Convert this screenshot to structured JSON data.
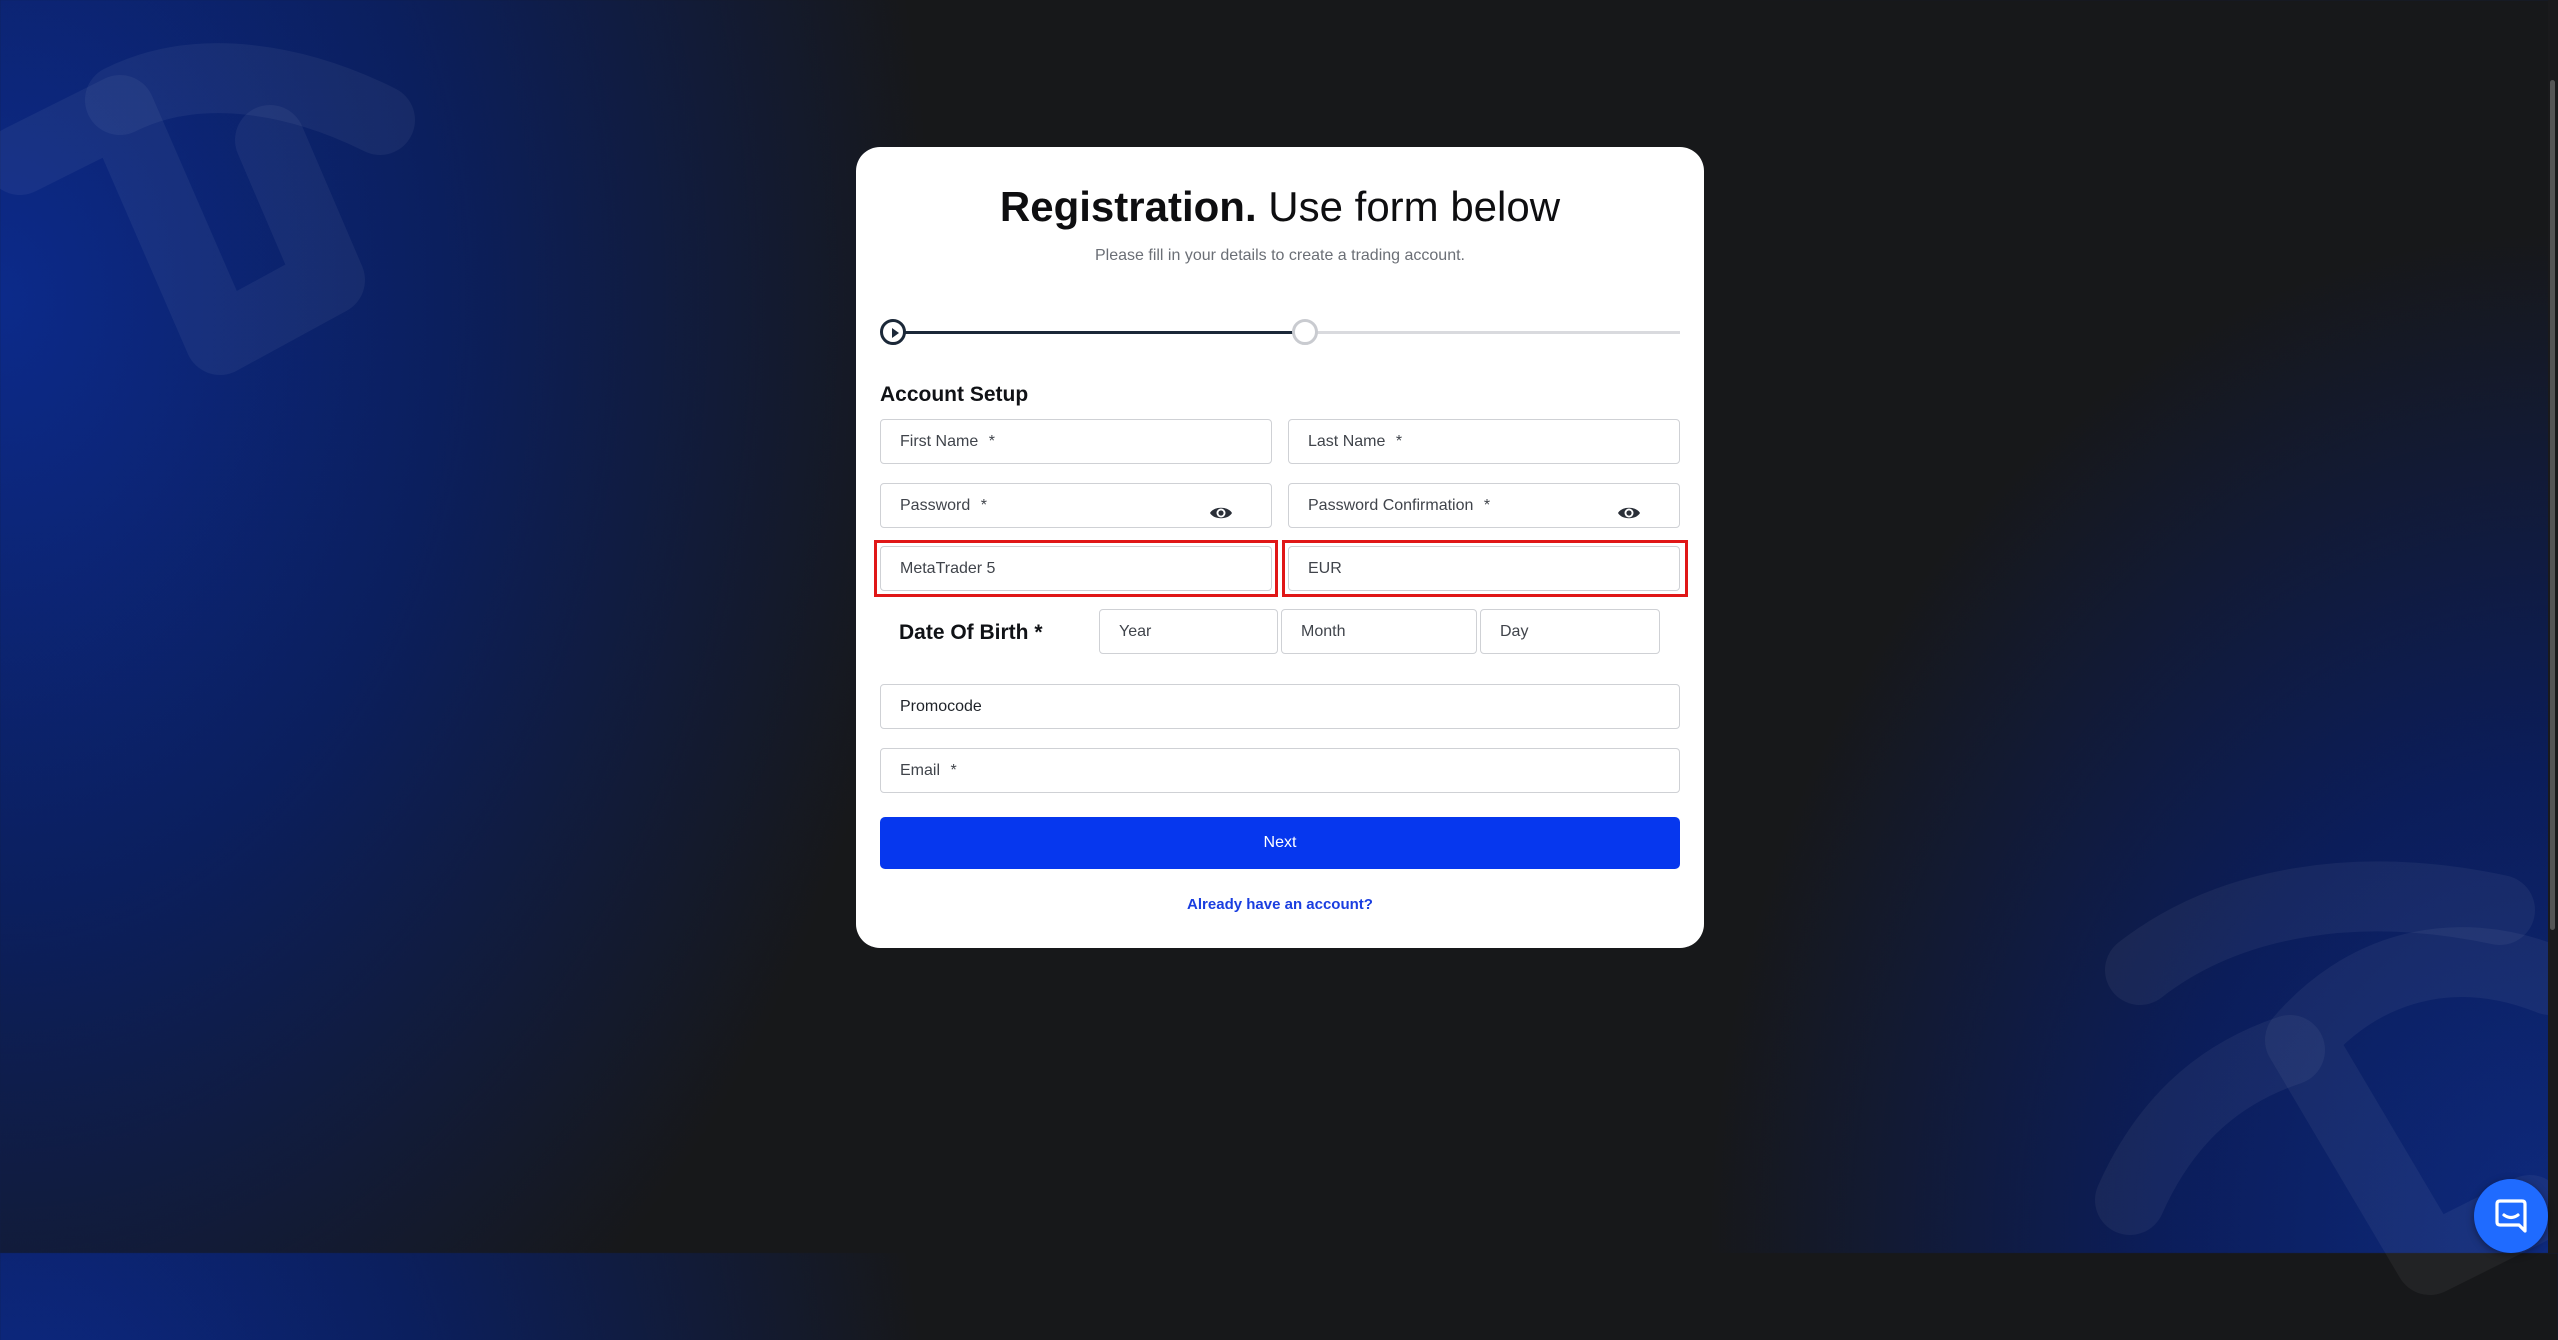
{
  "header": {
    "title_bold": "Registration.",
    "title_light": "Use form below",
    "subtitle": "Please fill in your details to create a trading account."
  },
  "progress": {
    "current_step": 1,
    "total_steps": 2,
    "fill_fraction": 0.5
  },
  "section_title": "Account Setup",
  "fields": {
    "first_name": {
      "placeholder": "First Name",
      "required_mark": "*"
    },
    "last_name": {
      "placeholder": "Last Name",
      "required_mark": "*"
    },
    "password": {
      "placeholder": "Password",
      "required_mark": "*"
    },
    "password_confirmation": {
      "placeholder": "Password Confirmation",
      "required_mark": "*"
    },
    "platform": {
      "value": "MetaTrader 5"
    },
    "currency": {
      "value": "EUR"
    },
    "promocode": {
      "placeholder": "Promocode"
    },
    "email": {
      "placeholder": "Email",
      "required_mark": "*"
    }
  },
  "dob": {
    "label": "Date Of Birth *",
    "year": "Year",
    "month": "Month",
    "day": "Day"
  },
  "buttons": {
    "next": "Next",
    "login_link": "Already have an account?"
  },
  "icons": {
    "password_toggle": "eye-icon",
    "chat": "chat-icon"
  },
  "colors": {
    "primary": "#0637ee",
    "highlight": "#e01717",
    "link": "#1a3ee0"
  }
}
